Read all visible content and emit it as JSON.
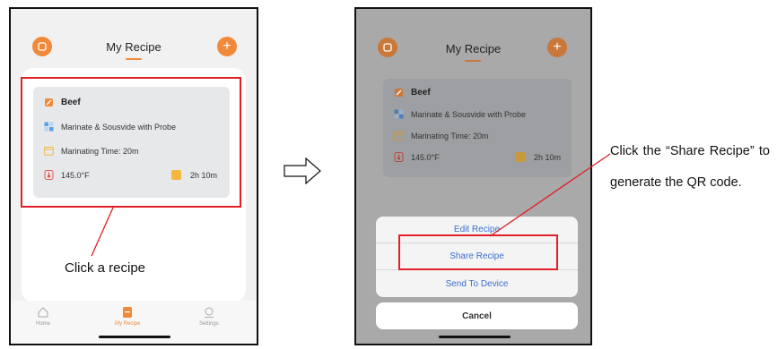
{
  "left_phone": {
    "header": {
      "title": "My Recipe"
    },
    "recipe": {
      "name": "Beef",
      "mode": "Marinate & Sousvide with Probe",
      "marinating": "Marinating Time: 20m",
      "temperature": "145.0°F",
      "duration": "2h 10m"
    },
    "annotation": "Click a recipe",
    "tabs": [
      {
        "label": "Home"
      },
      {
        "label": "My Recipe"
      },
      {
        "label": "Settings"
      }
    ]
  },
  "right_phone": {
    "header": {
      "title": "My Recipe"
    },
    "recipe": {
      "name": "Beef",
      "mode": "Marinate & Sousvide with Probe",
      "marinating": "Marinating Time: 20m",
      "temperature": "145.0°F",
      "duration": "2h 10m"
    },
    "actions": {
      "edit": "Edit Recipe",
      "share": "Share Recipe",
      "send": "Send To Device",
      "cancel": "Cancel"
    }
  },
  "instruction": "Click the “Share Recipe” to generate the QR code.",
  "colors": {
    "accent": "#f08a3a",
    "highlight_box": "#e01f26",
    "action_text": "#3a6fd0"
  },
  "icons": [
    "switch-icon",
    "plus-icon",
    "edit-icon",
    "mode-icon",
    "calendar-icon",
    "thermometer-icon",
    "timer-icon",
    "home-icon",
    "recipe-icon",
    "settings-icon",
    "arrow-right-icon"
  ]
}
